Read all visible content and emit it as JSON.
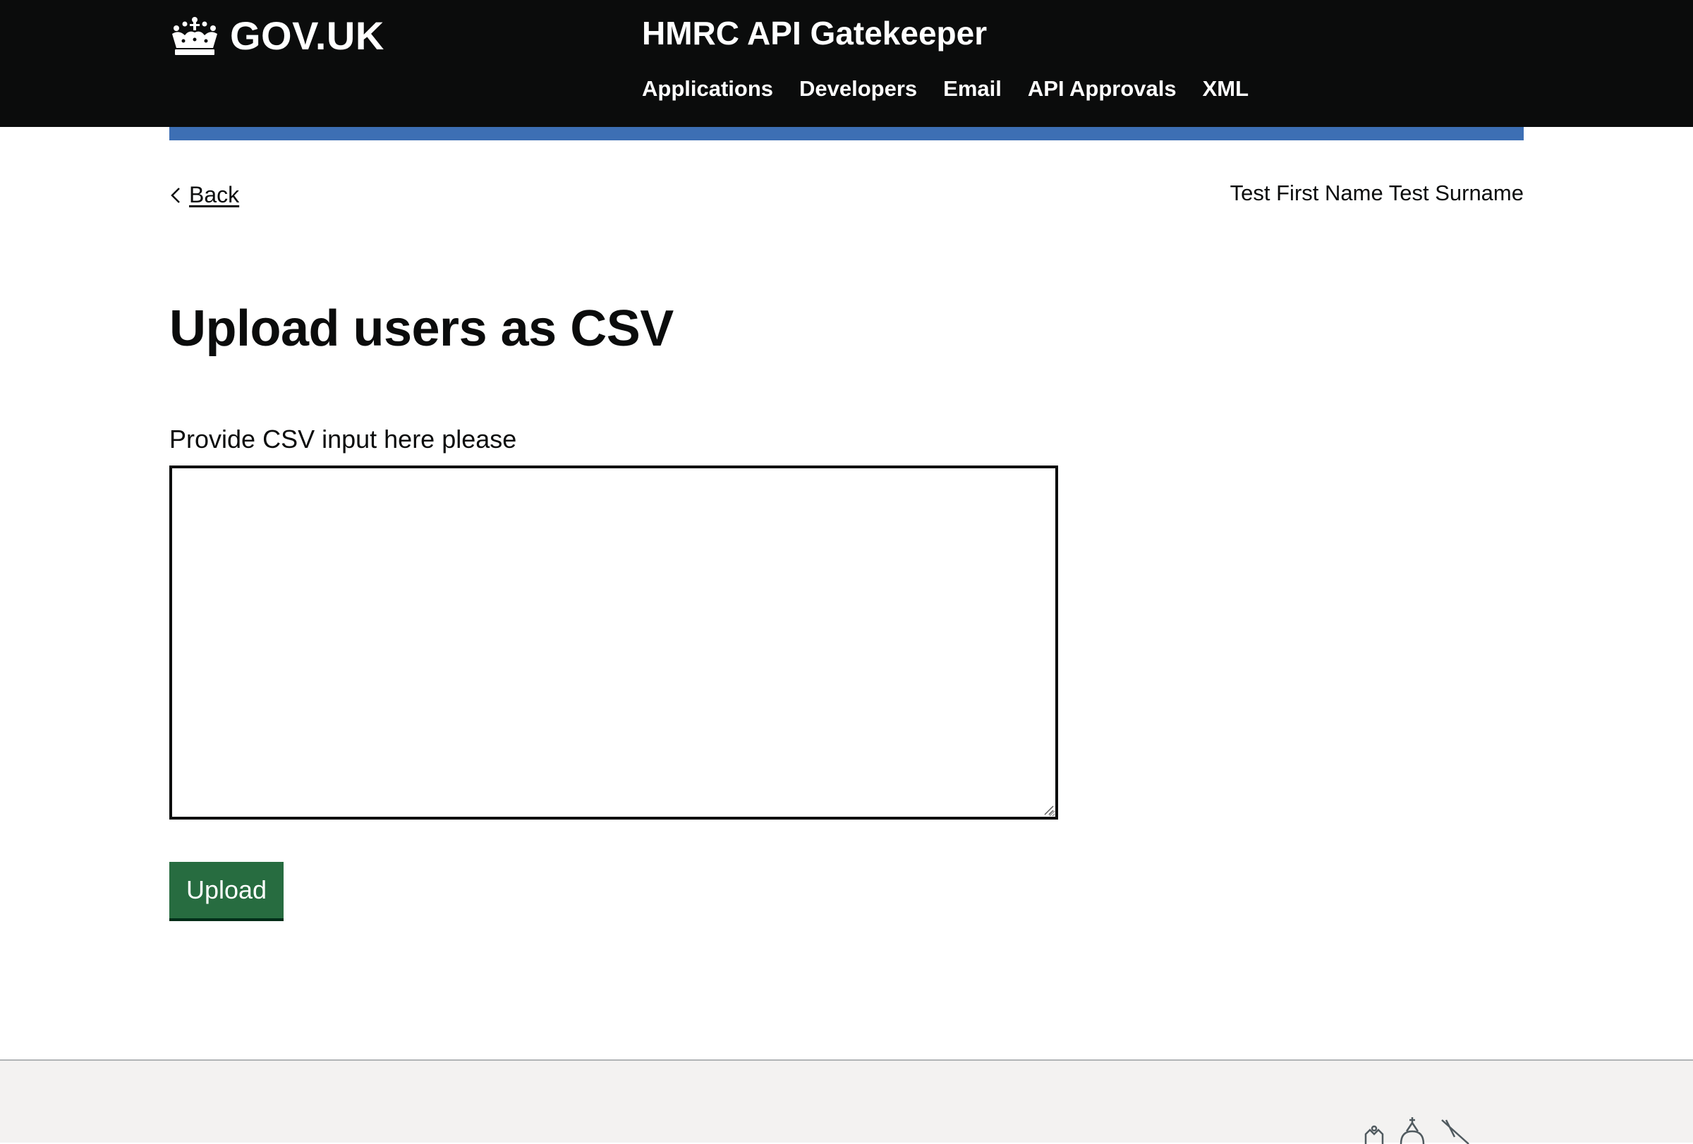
{
  "header": {
    "logo_text": "GOV.UK",
    "service_name": "HMRC API Gatekeeper",
    "nav": [
      {
        "label": "Applications"
      },
      {
        "label": "Developers"
      },
      {
        "label": "Email"
      },
      {
        "label": "API Approvals"
      },
      {
        "label": "XML"
      }
    ]
  },
  "back": {
    "label": "Back"
  },
  "user": {
    "name": "Test First Name Test Surname"
  },
  "main": {
    "title": "Upload users as CSV",
    "field_label": "Provide CSV input here please",
    "textarea_value": "",
    "upload_label": "Upload"
  },
  "colors": {
    "header_bg": "#0b0c0c",
    "accent_bar": "#3d6fb4",
    "button_green": "#276c40",
    "footer_bg": "#f3f2f1"
  },
  "icons": {
    "logo": "crown-icon",
    "back": "chevron-left-icon",
    "footer": "royal-crest-icon"
  }
}
